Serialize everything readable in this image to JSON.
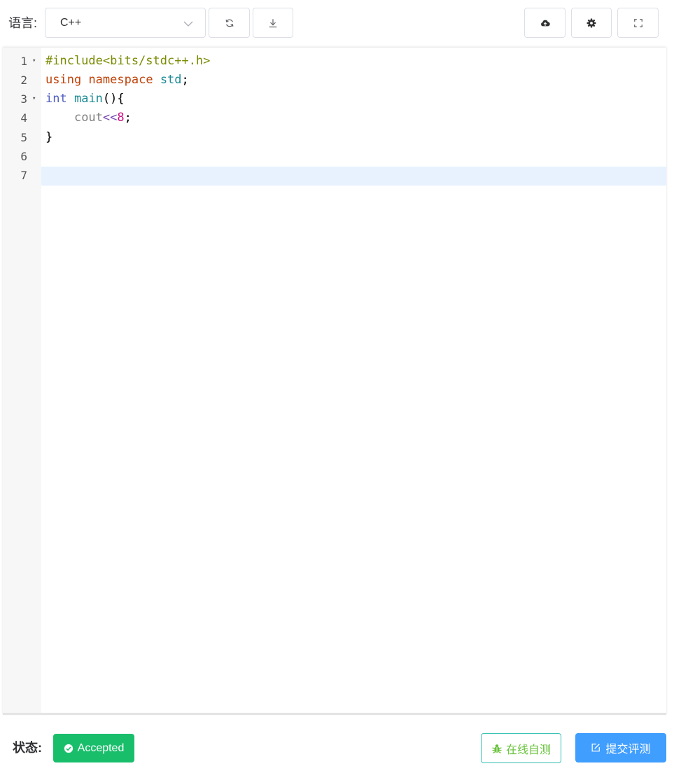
{
  "toolbar": {
    "language_label": "语言:",
    "language_selected": "C++",
    "icons": {
      "reset": "refresh-icon",
      "download": "download-icon",
      "upload": "cloud-upload-icon",
      "settings": "gear-icon",
      "fullscreen": "fullscreen-icon"
    }
  },
  "editor": {
    "line_numbers": [
      "1",
      "2",
      "3",
      "4",
      "5",
      "6",
      "7"
    ],
    "active_line": 7,
    "code": {
      "line1": {
        "meta": "#include<bits/stdc++.h>"
      },
      "line2": {
        "kw": "using",
        "sp1": " ",
        "kw2": "namespace",
        "sp2": " ",
        "ns": "std",
        "punc": ";"
      },
      "line3": {
        "type": "int",
        "sp": " ",
        "fn": "main",
        "punc": "(){"
      },
      "line4": {
        "indent": "    ",
        "ident": "cout",
        "op": "<<",
        "num": "8",
        "punc": ";"
      },
      "line5": {
        "punc": "}"
      }
    },
    "fold_marker": "▾"
  },
  "footer": {
    "status_label": "状态:",
    "status_value": "Accepted",
    "test_button": "在线自测",
    "submit_button": "提交评测"
  },
  "colors": {
    "accepted": "#19be6b",
    "primary": "#409eff",
    "success_text": "#67c23a",
    "active_line": "#e8f2ff"
  }
}
